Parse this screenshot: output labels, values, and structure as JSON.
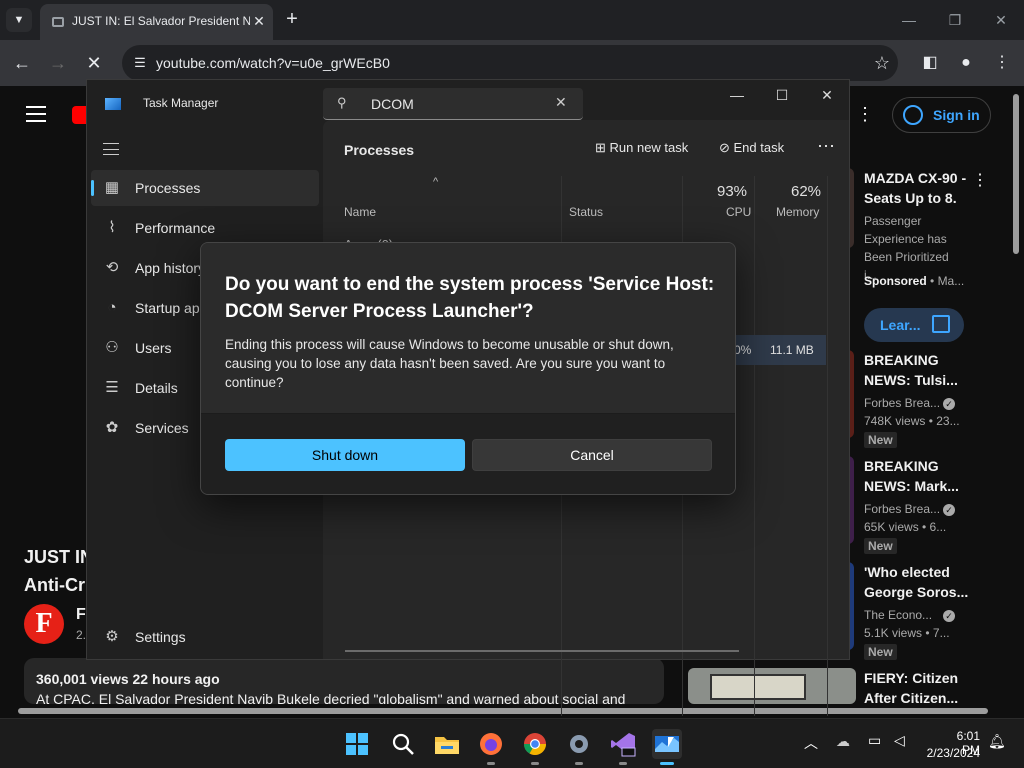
{
  "browser": {
    "tab": {
      "title": "JUST IN: El Salvador President Nayib",
      "close": "✕"
    },
    "new_tab": "+",
    "url": "youtube.com/watch?v=u0e_grWEcB0",
    "window": {
      "minimize": "—",
      "restore": "❐",
      "close": "✕"
    }
  },
  "youtube": {
    "sign_in": "Sign in",
    "video_title": [
      "JUST IN",
      "Anti-Cr"
    ],
    "channel_name": "Fo",
    "channel_sub": "2.",
    "channel_logo": "F",
    "views_meta": "360,001 views  22 hours ago",
    "description": "At CPAC, El Salvador President Nayib Bukele decried \"globalism\" and warned about social and",
    "ad": {
      "title": "MAZDA CX-90 - Seats Up to 8.",
      "body": "Passenger Experience has Been Prioritized i...",
      "sponsored": "Sponsored",
      "advertiser": "Ma...",
      "cta": "Lear..."
    },
    "recs": [
      {
        "title": "BREAKING NEWS: Tulsi...",
        "channel": "Forbes Brea...",
        "views": "748K views  • 23...",
        "badge": "New"
      },
      {
        "title": "BREAKING NEWS: Mark...",
        "channel": "Forbes Brea...",
        "views": "65K views  • 6...",
        "badge": "New"
      },
      {
        "title": "'Who elected George Soros...",
        "channel": "The Econo...",
        "views": "5.1K views  • 7...",
        "badge": "New"
      },
      {
        "title": "FIERY: Citizen After Citizen..."
      }
    ]
  },
  "task_manager": {
    "title": "Task Manager",
    "search_value": "DCOM",
    "nav": [
      {
        "label": "Processes",
        "icon": "processes-icon"
      },
      {
        "label": "Performance",
        "icon": "performance-icon"
      },
      {
        "label": "App history",
        "icon": "app-history-icon"
      },
      {
        "label": "Startup apps",
        "icon": "startup-apps-icon"
      },
      {
        "label": "Users",
        "icon": "users-icon"
      },
      {
        "label": "Details",
        "icon": "details-icon"
      },
      {
        "label": "Services",
        "icon": "services-icon"
      }
    ],
    "settings": "Settings",
    "page_title": "Processes",
    "run_new_task": "Run new task",
    "end_task": "End task",
    "columns": {
      "name": "Name",
      "status": "Status",
      "cpu_pct": "93%",
      "cpu": "CPU",
      "mem_pct": "62%",
      "memory": "Memory"
    },
    "group": "Apps (0)",
    "row": {
      "cpu": "0%",
      "memory": "11.1 MB"
    }
  },
  "dialog": {
    "title": "Do you want to end the system process 'Service Host: DCOM Server Process Launcher'?",
    "body": "Ending this process will cause Windows to become unusable or shut down, causing you to lose any data hasn't been saved. Are you sure you want to continue?",
    "primary": "Shut down",
    "secondary": "Cancel"
  },
  "taskbar": {
    "time": "6:01 PM",
    "date": "2/23/2024"
  }
}
